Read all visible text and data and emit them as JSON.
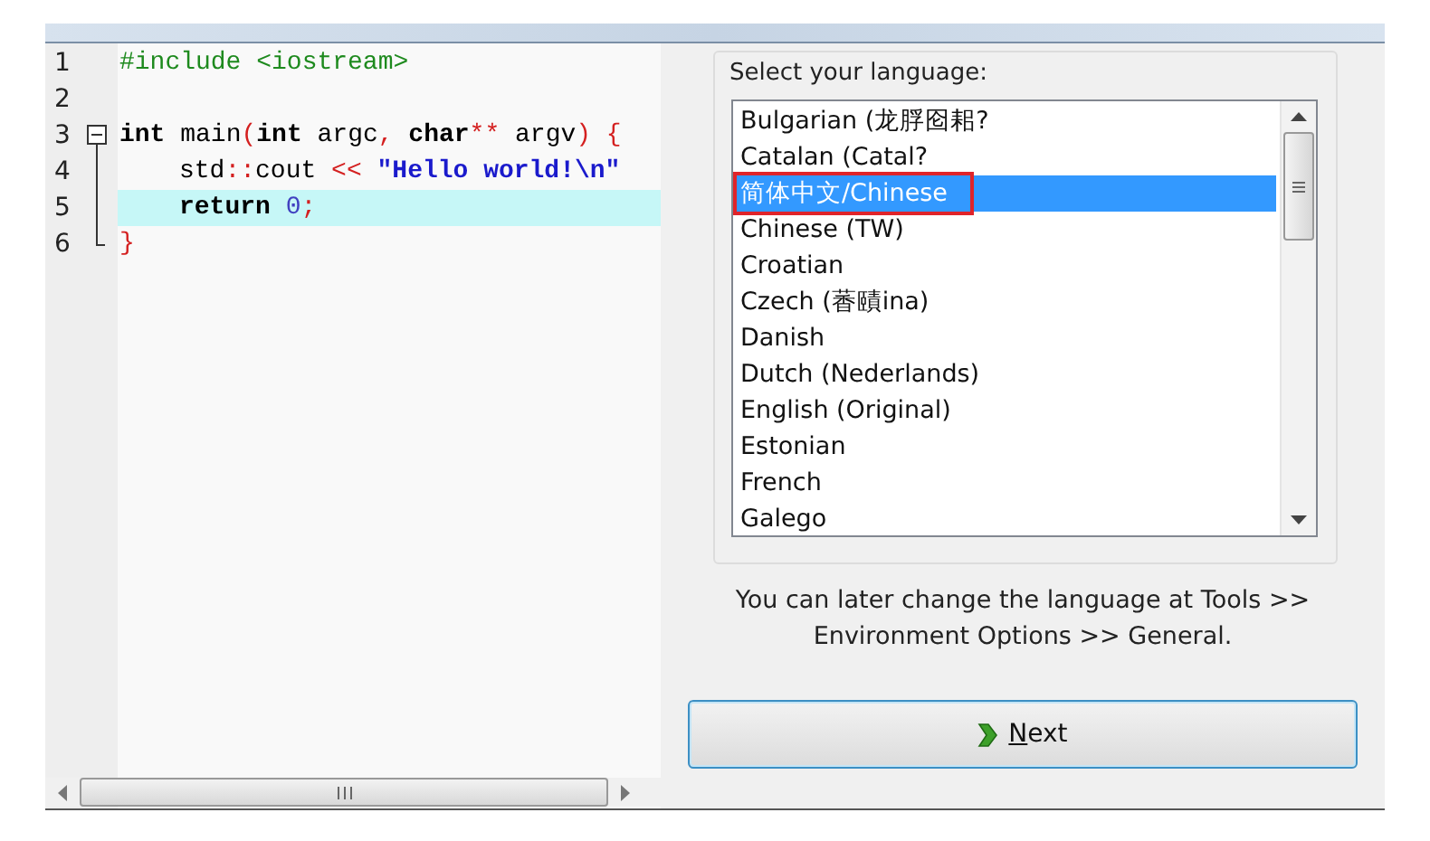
{
  "editor": {
    "lines": [
      {
        "number": "1",
        "highlighted": false,
        "indented": false,
        "tokens": [
          {
            "text": "#include <iostream>",
            "kind": "preproc"
          }
        ]
      },
      {
        "number": "2",
        "highlighted": false
      },
      {
        "number": "3",
        "kind": "fold-start",
        "highlighted": false,
        "indented": false,
        "tokens": [
          {
            "text": "int",
            "kind": "keyword"
          },
          {
            "text": " main",
            "kind": "plain"
          },
          {
            "text": "(",
            "kind": "symbol"
          },
          {
            "text": "int",
            "kind": "keyword"
          },
          {
            "text": " argc",
            "kind": "plain"
          },
          {
            "text": ",",
            "kind": "symbol"
          },
          {
            "text": " char",
            "kind": "keyword"
          },
          {
            "text": "**",
            "kind": "symbol"
          },
          {
            "text": " argv",
            "kind": "plain"
          },
          {
            "text": ")",
            "kind": "symbol"
          },
          {
            "text": " {",
            "kind": "symbol"
          }
        ]
      },
      {
        "number": "4",
        "kind": "fold-line",
        "highlighted": false,
        "indented": true,
        "tokens": [
          {
            "text": "std",
            "kind": "plain"
          },
          {
            "text": "::",
            "kind": "symbol"
          },
          {
            "text": "cout",
            "kind": "plain"
          },
          {
            "text": " <<",
            "kind": "symbol"
          },
          {
            "text": " \"Hello world!\\n\"",
            "kind": "string"
          }
        ]
      },
      {
        "number": "5",
        "kind": "fold-line",
        "highlighted": true,
        "indented": true,
        "tokens": [
          {
            "text": "return",
            "kind": "keyword"
          },
          {
            "text": " 0",
            "kind": "number"
          },
          {
            "text": ";",
            "kind": "symbol"
          }
        ]
      },
      {
        "number": "6",
        "kind": "fold-end",
        "highlighted": false,
        "indented": false,
        "tokens": [
          {
            "text": "}",
            "kind": "symbol"
          }
        ]
      }
    ]
  },
  "language": {
    "label": "Select your language:",
    "items": [
      {
        "label": "Bulgarian (龙脬囵耜?",
        "selected": false,
        "annotated": false
      },
      {
        "label": "Catalan (Catal?",
        "selected": false,
        "annotated": false
      },
      {
        "label": "简体中文/Chinese",
        "selected": true,
        "annotated": true
      },
      {
        "label": "Chinese (TW)",
        "selected": false,
        "annotated": false
      },
      {
        "label": "Croatian",
        "selected": false,
        "annotated": false
      },
      {
        "label": "Czech (萫賾ina)",
        "selected": false,
        "annotated": false
      },
      {
        "label": "Danish",
        "selected": false,
        "annotated": false
      },
      {
        "label": "Dutch (Nederlands)",
        "selected": false,
        "annotated": false
      },
      {
        "label": "English (Original)",
        "selected": false,
        "annotated": false
      },
      {
        "label": "Estonian",
        "selected": false,
        "annotated": false
      },
      {
        "label": "French",
        "selected": false,
        "annotated": false
      },
      {
        "label": "Galego",
        "selected": false,
        "annotated": false
      }
    ]
  },
  "note": "You can later change the language at Tools >> Environment Options >> General.",
  "next_button": {
    "label": "Next",
    "mnemonic_underlined": true
  }
}
